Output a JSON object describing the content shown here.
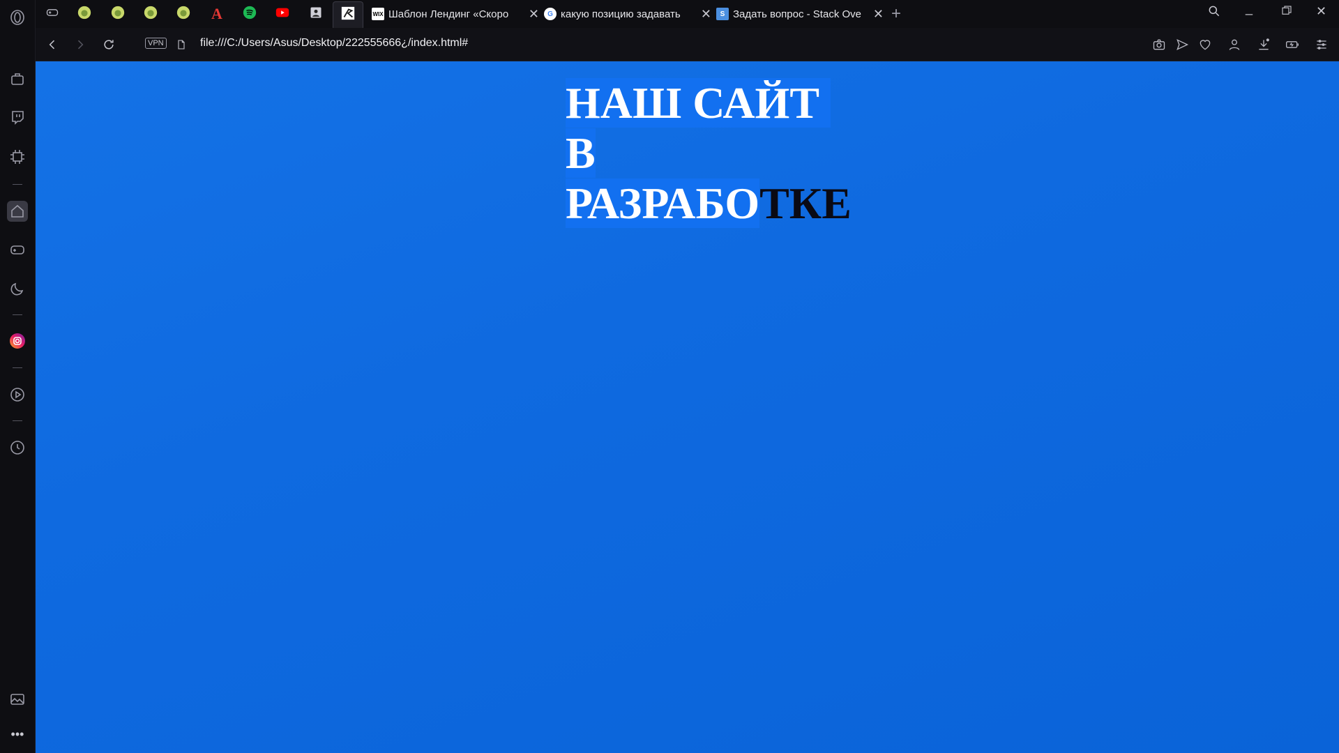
{
  "browser": {
    "pinned_tabs": [
      {
        "icon": "gamepad-icon"
      },
      {
        "icon": "pear-icon"
      },
      {
        "icon": "pear-icon"
      },
      {
        "icon": "pear-icon"
      },
      {
        "icon": "pear-icon"
      },
      {
        "icon": "acrobat-icon",
        "glyph": "A"
      },
      {
        "icon": "spotify-icon"
      },
      {
        "icon": "youtube-icon"
      },
      {
        "icon": "contacts-icon"
      },
      {
        "icon": "active-site-icon"
      }
    ],
    "tabs": [
      {
        "title": "Шаблон Лендинг «Скоро",
        "favicon": "WIX",
        "favicon_icon": "wix-icon"
      },
      {
        "title": "какую позицию задавать",
        "favicon": "G",
        "favicon_icon": "google-icon"
      },
      {
        "title": "Задать вопрос - Stack Ove",
        "favicon": "S",
        "favicon_icon": "stackoverflow-icon"
      }
    ],
    "address": {
      "vpn_label": "VPN",
      "url": "file:///C:/Users/Asus/Desktop/222555666¿/index.html#"
    }
  },
  "page": {
    "heading_selected_1": "НАШ САЙТ",
    "heading_selected_2": "В",
    "heading_selected_3": "РАЗРАБО",
    "heading_unselected": "ТКЕ"
  },
  "colors": {
    "page_background": "#0f6ae0",
    "selection": "#1270f0",
    "heading_text": "#ffffff"
  }
}
